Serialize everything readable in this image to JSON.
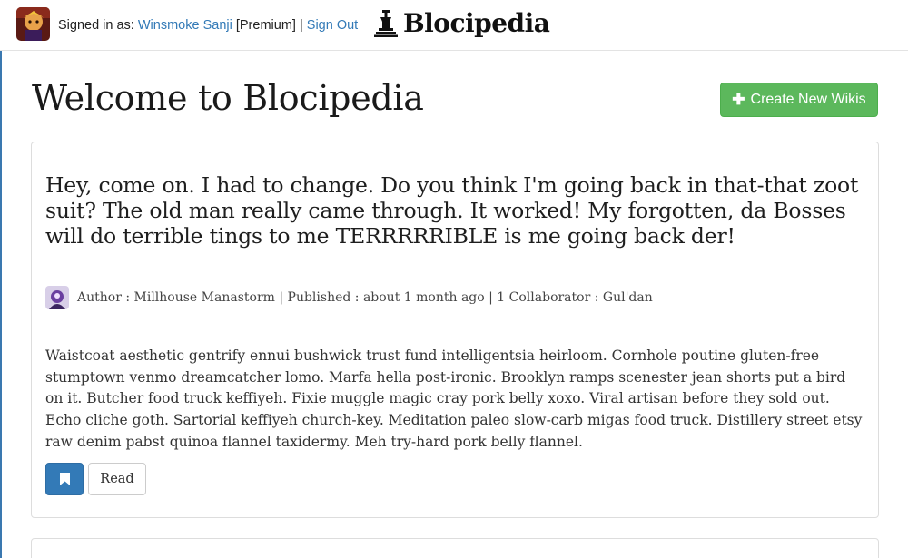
{
  "header": {
    "signed_in_prefix": "Signed in as:",
    "user_name": "Winsmoke Sanji",
    "membership": "[Premium]",
    "separator": "|",
    "sign_out_label": "Sign Out",
    "brand_name": "Blocipedia",
    "brand_icon": "chess-pawn-icon"
  },
  "main": {
    "title": "Welcome to Blocipedia",
    "create_button_label": "Create New Wikis"
  },
  "wiki": {
    "title": "Hey, come on. I had to change. Do you think I'm going back in that-that zoot suit? The old man really came through. It worked! My forgotten, da Bosses will do terrible tings to me TERRRRRIBLE is me going back der!",
    "meta": "Author : Millhouse Manastorm | Published : about 1 month ago | 1 Collaborator : Gul'dan",
    "body": "Waistcoat aesthetic gentrify ennui bushwick trust fund intelligentsia heirloom. Cornhole poutine gluten-free stumptown venmo dreamcatcher lomo. Marfa hella post-ironic. Brooklyn ramps scenester jean shorts put a bird on it. Butcher food truck keffiyeh. Fixie muggle magic cray pork belly xoxo. Viral artisan before they sold out. Echo cliche goth. Sartorial keffiyeh church-key. Meditation paleo slow-carb migas food truck. Distillery street etsy raw denim pabst quinoa flannel taxidermy. Meh try-hard pork belly flannel.",
    "bookmark_icon": "bookmark-icon",
    "read_label": "Read"
  },
  "colors": {
    "link": "#337ab7",
    "success": "#5cb85c",
    "primary": "#337ab7"
  }
}
